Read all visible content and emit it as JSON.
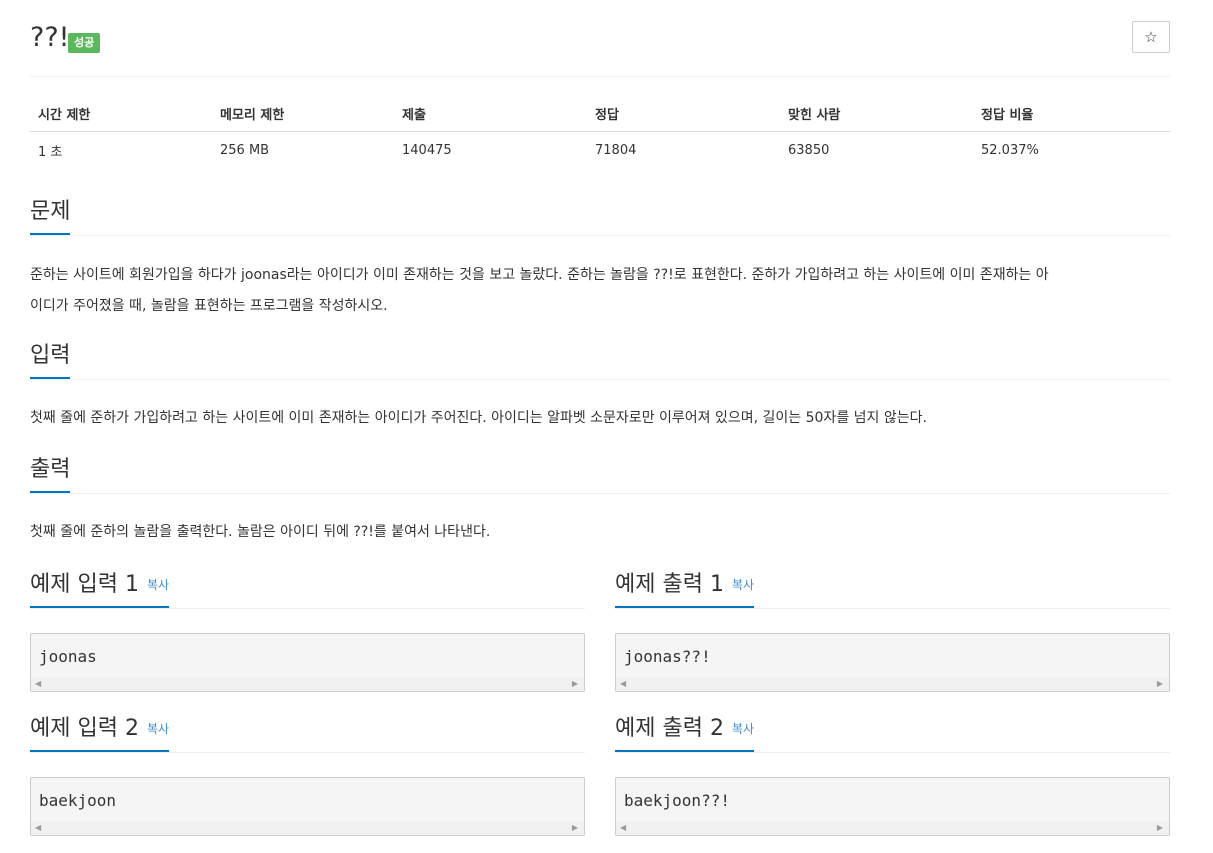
{
  "problem": {
    "title": "??!",
    "badge": "성공",
    "star_icon": "star-icon"
  },
  "info_table": {
    "headers": [
      "시간 제한",
      "메모리 제한",
      "제출",
      "정답",
      "맞힌 사람",
      "정답 비율"
    ],
    "values": [
      "1 초",
      "256 MB",
      "140475",
      "71804",
      "63850",
      "52.037%"
    ]
  },
  "sections": {
    "description": {
      "title": "문제",
      "line1": "준하는 사이트에 회원가입을 하다가 joonas라는 아이디가 이미 존재하는 것을 보고 놀랐다. 준하는 놀람을 ??!로 표현한다. 준하가 가입하려고 하는 사이트에 이미 존재하는 아",
      "line2": "이디가 주어졌을 때, 놀람을 표현하는 프로그램을 작성하시오."
    },
    "input": {
      "title": "입력",
      "text": "첫째 줄에 준하가 가입하려고 하는 사이트에 이미 존재하는 아이디가 주어진다. 아이디는 알파벳 소문자로만 이루어져 있으며, 길이는 50자를 넘지 않는다."
    },
    "output": {
      "title": "출력",
      "text": "첫째 줄에 준하의 놀람을 출력한다. 놀람은 아이디 뒤에 ??!를 붙여서 나타낸다."
    }
  },
  "samples": {
    "copy_label": "복사",
    "input1": {
      "title": "예제 입력 1",
      "code": "joonas"
    },
    "output1": {
      "title": "예제 출력 1",
      "code": "joonas??!"
    },
    "input2": {
      "title": "예제 입력 2",
      "code": "baekjoon"
    },
    "output2": {
      "title": "예제 출력 2",
      "code": "baekjoon??!"
    }
  },
  "colors": {
    "accent": "#0076c0",
    "badge_success": "#5cb85c",
    "link": "#428bca"
  }
}
